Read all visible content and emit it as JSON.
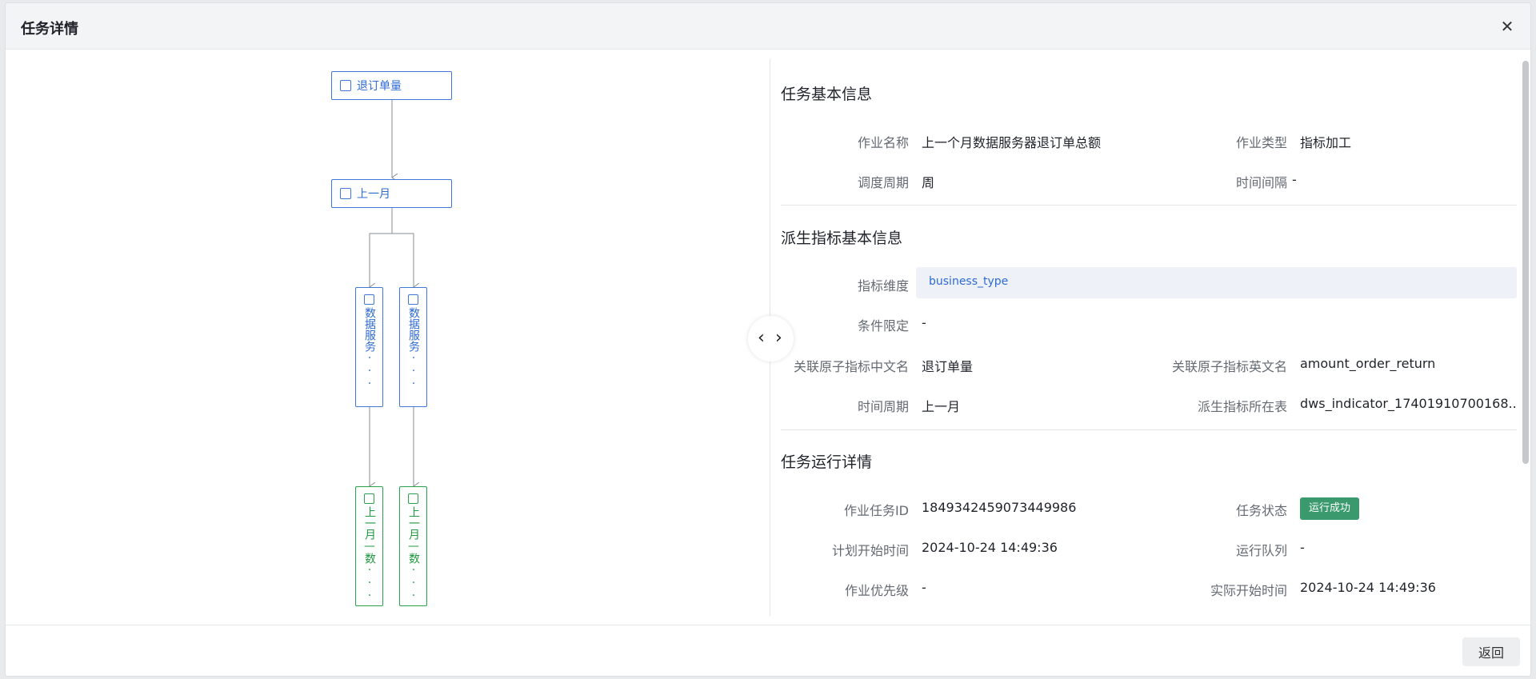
{
  "dialog": {
    "title": "任务详情",
    "close_icon": "close-icon"
  },
  "lineage": {
    "root": {
      "label": "退订单量",
      "icon": "chart-icon"
    },
    "period": {
      "label": "上一月",
      "icon": "period-icon"
    },
    "services": [
      {
        "label": "数据服务···",
        "icon": "service-icon"
      },
      {
        "label": "数据服务···",
        "icon": "service-icon"
      }
    ],
    "outputs": [
      {
        "label": "上一月—数···",
        "icon": "table-icon"
      },
      {
        "label": "上一月—数···",
        "icon": "table-icon"
      }
    ]
  },
  "basic": {
    "title": "任务基本信息",
    "job_name_label": "作业名称",
    "job_name": "上一个月数据服务器退订单总额",
    "job_type_label": "作业类型",
    "job_type": "指标加工",
    "schedule_label": "调度周期",
    "schedule": "周",
    "interval_label": "时间间隔",
    "interval": "-"
  },
  "derived": {
    "title": "派生指标基本信息",
    "dimension_label": "指标维度",
    "dimension": "business_type",
    "condition_label": "条件限定",
    "condition": "-",
    "atom_cn_label": "关联原子指标中文名",
    "atom_cn": "退订单量",
    "atom_en_label": "关联原子指标英文名",
    "atom_en": "amount_order_return",
    "period_label": "时间周期",
    "period": "上一月",
    "table_label": "派生指标所在表",
    "table": "dws_indicator_17401910700168..."
  },
  "run": {
    "title": "任务运行详情",
    "task_id_label": "作业任务ID",
    "task_id": "1849342459073449986",
    "status_label": "任务状态",
    "status": "运行成功",
    "plan_start_label": "计划开始时间",
    "plan_start": "2024-10-24 14:49:36",
    "queue_label": "运行队列",
    "queue": "-",
    "priority_label": "作业优先级",
    "priority": "-",
    "actual_start_label": "实际开始时间",
    "actual_start": "2024-10-24 14:49:36"
  },
  "footer": {
    "back_label": "返回"
  },
  "colors": {
    "node_blue": "#3e77d6",
    "node_green": "#2ba24c",
    "status_success": "#3a9a6e"
  }
}
